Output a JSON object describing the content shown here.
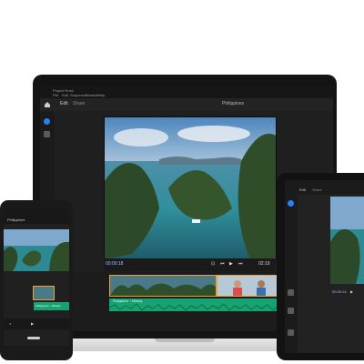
{
  "app": {
    "window_title": "Project Rush",
    "menu": [
      "File",
      "Edit",
      "Sequence",
      "Window",
      "Help"
    ],
    "tabs": [
      "Edit",
      "Share"
    ],
    "project_name": "Philippines"
  },
  "playback": {
    "current_time": "00:00:18",
    "total_time": "02:19"
  },
  "timeline": {
    "audio_track_label": "Philippines ~ Melody"
  },
  "phone": {
    "title": "Philippines",
    "audio_label": "Philippines ~ Melody"
  },
  "tablet": {
    "tabs": [
      "Edit",
      "Share"
    ],
    "time": "00:00:14"
  },
  "colors": {
    "accent": "#2d7ff9",
    "audio": "#17a371",
    "clip_border": "#f0a030",
    "ui_dark": "#1f1f1f"
  },
  "icons": [
    "home-icon",
    "plus-icon",
    "play-icon",
    "skip-back-icon",
    "skip-forward-icon",
    "crop-icon",
    "gear-icon"
  ]
}
